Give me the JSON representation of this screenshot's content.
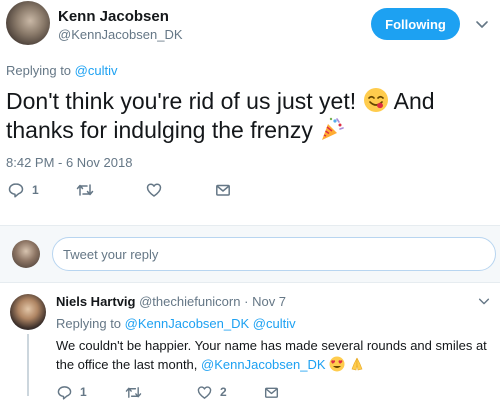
{
  "tweet": {
    "author_name": "Kenn Jacobsen",
    "author_handle": "@KennJacobsen_DK",
    "follow_label": "Following",
    "replying_prefix": "Replying to",
    "replying_to": "@cultiv",
    "text_part1": "Don't think you're rid of us just yet!",
    "text_part2": "And thanks for indulging the frenzy",
    "emoji_1": "savoring-food-face-emoji",
    "emoji_2": "party-popper-emoji",
    "timestamp": "8:42 PM - 6 Nov 2018",
    "reply_count": "1",
    "retweet_count": "",
    "like_count": ""
  },
  "reply_box": {
    "placeholder": "Tweet your reply"
  },
  "reply": {
    "author_name": "Niels Hartvig",
    "author_handle": "@thechiefunicorn",
    "separator": "·",
    "date": "Nov 7",
    "replying_prefix": "Replying to",
    "replying_to_1": "@KennJacobsen_DK",
    "replying_to_2": "@cultiv",
    "text": "We couldn't be happier. Your name has made several rounds and smiles at the office the last month,",
    "text_mention": "@KennJacobsen_DK",
    "emojis": [
      "heart-eyes-emoji",
      "folded-hands-emoji"
    ],
    "reply_count": "1",
    "retweet_count": "",
    "like_count": "2"
  },
  "colors": {
    "accent": "#1da1f2",
    "text": "#14171a",
    "secondary": "#657786"
  }
}
